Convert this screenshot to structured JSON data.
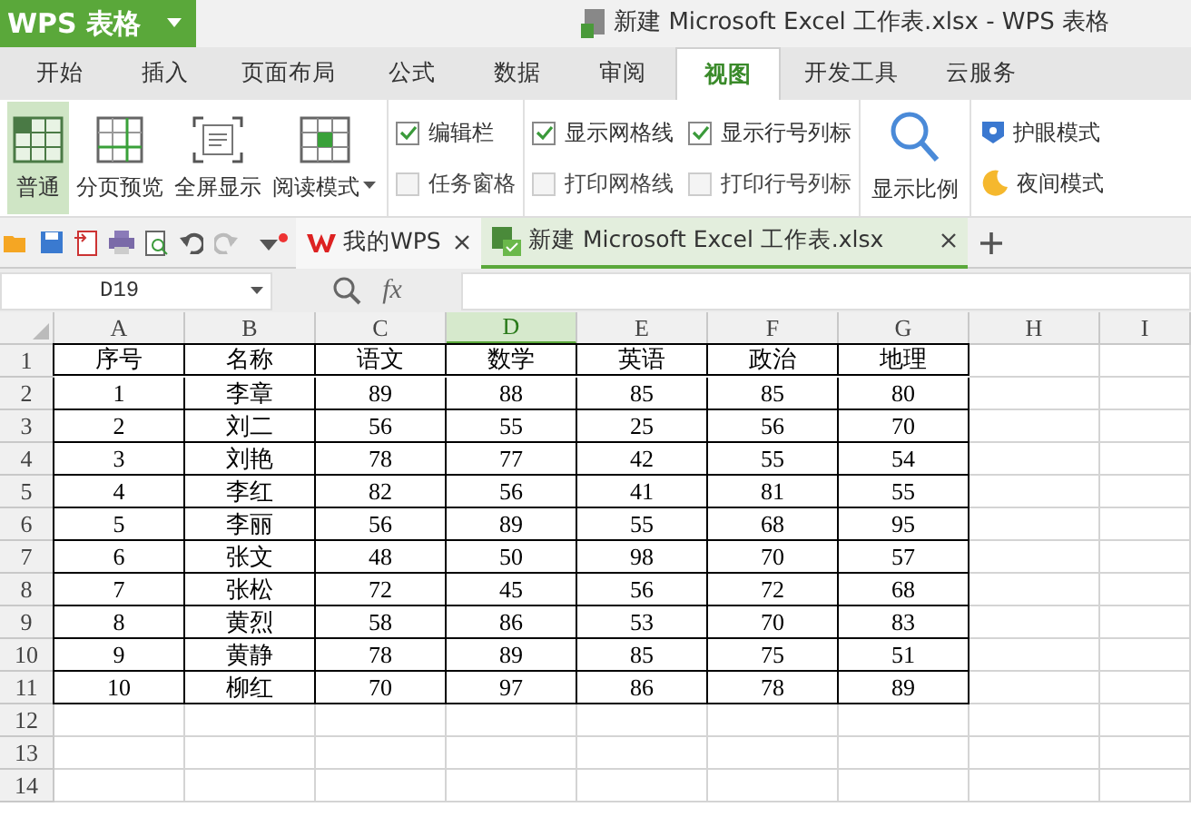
{
  "title_bar": {
    "app_menu": "WPS 表格",
    "document_title": "新建 Microsoft Excel 工作表.xlsx - WPS 表格"
  },
  "ribbon_tabs": [
    {
      "label": "开始",
      "selected": false
    },
    {
      "label": "插入",
      "selected": false
    },
    {
      "label": "页面布局",
      "selected": false
    },
    {
      "label": "公式",
      "selected": false
    },
    {
      "label": "数据",
      "selected": false
    },
    {
      "label": "审阅",
      "selected": false
    },
    {
      "label": "视图",
      "selected": true
    },
    {
      "label": "开发工具",
      "selected": false
    },
    {
      "label": "云服务",
      "selected": false
    }
  ],
  "view_buttons": [
    {
      "label": "普通",
      "selected": true,
      "kind": "normal",
      "dropdown": false
    },
    {
      "label": "分页预览",
      "selected": false,
      "kind": "pagebreak",
      "dropdown": false
    },
    {
      "label": "全屏显示",
      "selected": false,
      "kind": "fullscreen",
      "dropdown": false
    },
    {
      "label": "阅读模式",
      "selected": false,
      "kind": "reading",
      "dropdown": true
    }
  ],
  "checkbox_columns": [
    [
      {
        "label": "编辑栏",
        "checked": true
      },
      {
        "label": "任务窗格",
        "checked": false
      }
    ],
    [
      {
        "label": "显示网格线",
        "checked": true
      },
      {
        "label": "打印网格线",
        "checked": false
      }
    ],
    [
      {
        "label": "显示行号列标",
        "checked": true
      },
      {
        "label": "打印行号列标",
        "checked": false
      }
    ]
  ],
  "zoom_button": {
    "label": "显示比例"
  },
  "mode_buttons": [
    {
      "label": "护眼模式",
      "kind": "eye"
    },
    {
      "label": "夜间模式",
      "kind": "night"
    }
  ],
  "document_tabs": [
    {
      "label": "我的WPS",
      "selected": false,
      "kind": "home"
    },
    {
      "label": "新建 Microsoft Excel 工作表.xlsx",
      "selected": true,
      "kind": "sheet"
    }
  ],
  "name_box": {
    "value": "D19"
  },
  "formula_bar": {
    "function_label": "fx"
  },
  "columns": [
    {
      "label": "A",
      "selected": false
    },
    {
      "label": "B",
      "selected": false
    },
    {
      "label": "C",
      "selected": false
    },
    {
      "label": "D",
      "selected": true
    },
    {
      "label": "E",
      "selected": false
    },
    {
      "label": "F",
      "selected": false
    },
    {
      "label": "G",
      "selected": false
    },
    {
      "label": "H",
      "selected": false
    },
    {
      "label": "I",
      "selected": false
    }
  ],
  "row_numbers": [
    "1",
    "2",
    "3",
    "4",
    "5",
    "6",
    "7",
    "8",
    "9",
    "10",
    "11",
    "12",
    "13",
    "14"
  ],
  "rows": [
    [
      "序号",
      "名称",
      "语文",
      "数学",
      "英语",
      "政治",
      "地理"
    ],
    [
      "1",
      "李章",
      "89",
      "88",
      "85",
      "85",
      "80"
    ],
    [
      "2",
      "刘二",
      "56",
      "55",
      "25",
      "56",
      "70"
    ],
    [
      "3",
      "刘艳",
      "78",
      "77",
      "42",
      "55",
      "54"
    ],
    [
      "4",
      "李红",
      "82",
      "56",
      "41",
      "81",
      "55"
    ],
    [
      "5",
      "李丽",
      "56",
      "89",
      "55",
      "68",
      "95"
    ],
    [
      "6",
      "张文",
      "48",
      "50",
      "98",
      "70",
      "57"
    ],
    [
      "7",
      "张松",
      "72",
      "45",
      "56",
      "72",
      "68"
    ],
    [
      "8",
      "黄烈",
      "58",
      "86",
      "53",
      "70",
      "83"
    ],
    [
      "9",
      "黄静",
      "78",
      "89",
      "85",
      "75",
      "51"
    ],
    [
      "10",
      "柳红",
      "70",
      "97",
      "86",
      "78",
      "89"
    ]
  ]
}
